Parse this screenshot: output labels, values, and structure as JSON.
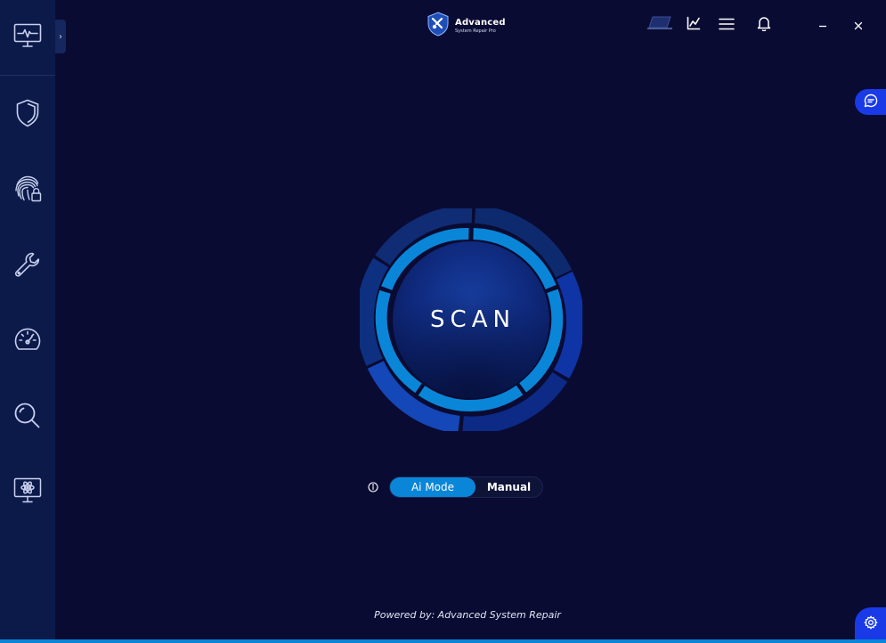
{
  "app": {
    "name": "Advanced",
    "subtitle": "System Repair Pro"
  },
  "sidebar": {
    "items": [
      {
        "icon": "monitor-pulse-icon"
      },
      {
        "icon": "shield-icon"
      },
      {
        "icon": "fingerprint-lock-icon"
      },
      {
        "icon": "wrench-icon"
      },
      {
        "icon": "speedometer-icon"
      },
      {
        "icon": "search-icon"
      },
      {
        "icon": "monitor-atom-icon"
      }
    ],
    "expand_glyph": "›"
  },
  "topbar": {
    "icons": [
      "laptop-icon",
      "chart-icon",
      "menu-icon",
      "bell-icon",
      "minimize-icon",
      "close-icon"
    ]
  },
  "scan": {
    "label": "SCAN"
  },
  "mode": {
    "options": [
      "Ai Mode",
      "Manual"
    ],
    "selected": "Ai Mode"
  },
  "footer": {
    "text": "Powered by: Advanced System Repair"
  },
  "colors": {
    "background": "#0a0b32",
    "sidebar": "#0c1a4a",
    "accent": "#0a86d8",
    "side_tab": "#1a3ae8"
  }
}
